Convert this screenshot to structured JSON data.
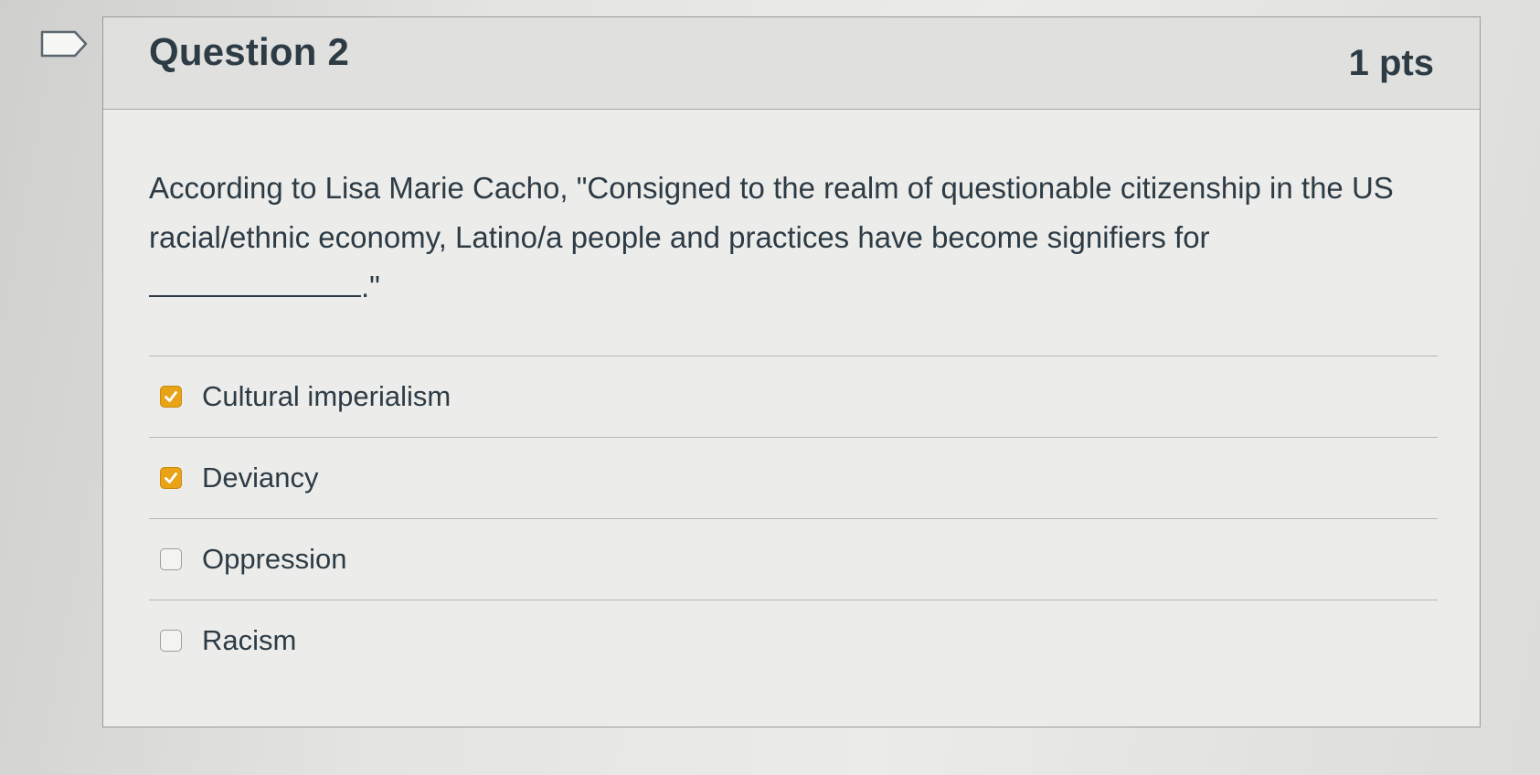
{
  "question": {
    "title": "Question 2",
    "points": "1 pts",
    "text_before_blank": "According to Lisa Marie Cacho, \"Consigned to the realm of questionable citizenship in the US racial/ethnic economy, Latino/a people and practices have become signifiers for ",
    "text_after_blank": ".\""
  },
  "answers": [
    {
      "label": "Cultural imperialism",
      "checked": true
    },
    {
      "label": "Deviancy",
      "checked": true
    },
    {
      "label": "Oppression",
      "checked": false
    },
    {
      "label": "Racism",
      "checked": false
    }
  ],
  "colors": {
    "checkbox_checked": "#e8a317",
    "text": "#2d3b45"
  },
  "icons": {
    "flag": "bookmark-flag-icon",
    "check": "checkmark-icon"
  }
}
